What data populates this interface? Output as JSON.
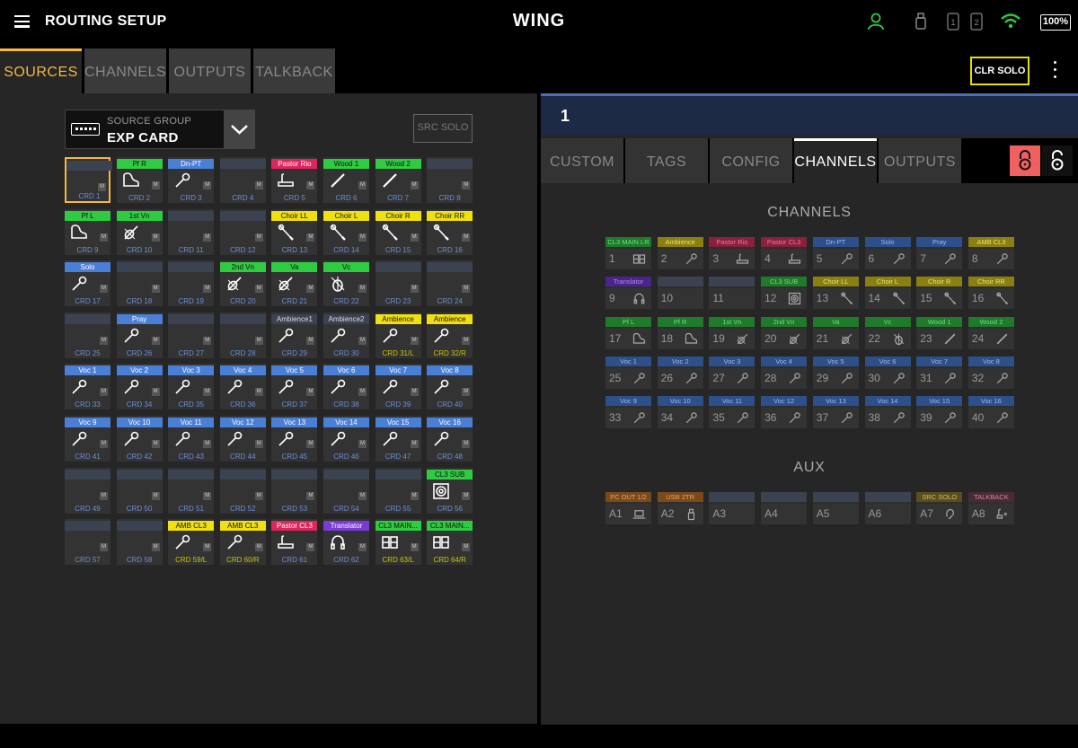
{
  "topbar": {
    "title": "ROUTING SETUP",
    "brand": "WING",
    "battery": "100%",
    "icons": [
      "user-icon",
      "usb-drive-icon",
      "card-slot-1-icon",
      "card-slot-2-icon",
      "wifi-icon",
      "battery-icon"
    ],
    "slot1": "1",
    "slot2": "2"
  },
  "left_tabs": [
    {
      "label": "SOURCES",
      "active": true
    },
    {
      "label": "CHANNELS",
      "active": false
    },
    {
      "label": "OUTPUTS",
      "active": false
    },
    {
      "label": "TALKBACK",
      "active": false
    }
  ],
  "source_group": {
    "label": "SOURCE GROUP",
    "value": "EXP CARD"
  },
  "src_solo_label": "SRC SOLO",
  "clr_solo_label": "CLR SOLO",
  "colors": {
    "green": "#2ecc40",
    "blue": "#4a7fd6",
    "red": "#e0245e",
    "yellow": "#f0e010",
    "purple": "#7a3ad6",
    "empty": "#3b4250",
    "accent": "#f6b93b"
  },
  "sources": [
    {
      "name": "CRD 1",
      "tag": "",
      "color": "empty",
      "icon": "",
      "selected": true
    },
    {
      "name": "CRD 2",
      "tag": "Pf R",
      "color": "green",
      "icon": "piano"
    },
    {
      "name": "CRD 3",
      "tag": "Dn-PT",
      "color": "blue",
      "icon": "mic"
    },
    {
      "name": "CRD 4",
      "tag": "",
      "color": "empty",
      "icon": ""
    },
    {
      "name": "CRD 5",
      "tag": "Pastor Rio",
      "color": "red",
      "icon": "podium"
    },
    {
      "name": "CRD 6",
      "tag": "Wood 1",
      "color": "green",
      "icon": "flute"
    },
    {
      "name": "CRD 7",
      "tag": "Wood 2",
      "color": "green",
      "icon": "flute"
    },
    {
      "name": "CRD 8",
      "tag": "",
      "color": "empty",
      "icon": ""
    },
    {
      "name": "CRD 9",
      "tag": "Pf L",
      "color": "green",
      "icon": "piano"
    },
    {
      "name": "CRD 10",
      "tag": "1st Vn",
      "color": "green",
      "icon": "violin"
    },
    {
      "name": "CRD 11",
      "tag": "",
      "color": "empty",
      "icon": ""
    },
    {
      "name": "CRD 12",
      "tag": "",
      "color": "empty",
      "icon": ""
    },
    {
      "name": "CRD 13",
      "tag": "Choir LL",
      "color": "yellow",
      "icon": "mic-hang"
    },
    {
      "name": "CRD 14",
      "tag": "Choir L",
      "color": "yellow",
      "icon": "mic-hang"
    },
    {
      "name": "CRD 15",
      "tag": "Choir R",
      "color": "yellow",
      "icon": "mic-hang"
    },
    {
      "name": "CRD 16",
      "tag": "Choir RR",
      "color": "yellow",
      "icon": "mic-hang"
    },
    {
      "name": "CRD 17",
      "tag": "Solo",
      "color": "blue",
      "icon": "mic"
    },
    {
      "name": "CRD 18",
      "tag": "",
      "color": "empty",
      "icon": ""
    },
    {
      "name": "CRD 19",
      "tag": "",
      "color": "empty",
      "icon": ""
    },
    {
      "name": "CRD 20",
      "tag": "2nd Vn",
      "color": "green",
      "icon": "violin"
    },
    {
      "name": "CRD 21",
      "tag": "Va",
      "color": "green",
      "icon": "violin"
    },
    {
      "name": "CRD 22",
      "tag": "Vc",
      "color": "green",
      "icon": "cello"
    },
    {
      "name": "CRD 23",
      "tag": "",
      "color": "empty",
      "icon": ""
    },
    {
      "name": "CRD 24",
      "tag": "",
      "color": "empty",
      "icon": ""
    },
    {
      "name": "CRD 25",
      "tag": "",
      "color": "empty",
      "icon": ""
    },
    {
      "name": "CRD 26",
      "tag": "Pray",
      "color": "blue",
      "icon": "mic"
    },
    {
      "name": "CRD 27",
      "tag": "",
      "color": "empty",
      "icon": ""
    },
    {
      "name": "CRD 28",
      "tag": "",
      "color": "empty",
      "icon": ""
    },
    {
      "name": "CRD 29",
      "tag": "Ambience1",
      "color": "empty",
      "icon": "mic",
      "textcolor": "#ddd"
    },
    {
      "name": "CRD 30",
      "tag": "Ambience2",
      "color": "empty",
      "icon": "mic",
      "textcolor": "#ddd"
    },
    {
      "name": "CRD 31/L",
      "tag": "Ambience",
      "color": "yellow",
      "icon": "mic",
      "namecolor": "#c8c800"
    },
    {
      "name": "CRD 32/R",
      "tag": "Ambience",
      "color": "yellow",
      "icon": "mic",
      "namecolor": "#c8c800"
    },
    {
      "name": "CRD 33",
      "tag": "Voc 1",
      "color": "blue",
      "icon": "mic"
    },
    {
      "name": "CRD 34",
      "tag": "Voc 2",
      "color": "blue",
      "icon": "mic"
    },
    {
      "name": "CRD 35",
      "tag": "Voc 3",
      "color": "blue",
      "icon": "mic"
    },
    {
      "name": "CRD 36",
      "tag": "Voc 4",
      "color": "blue",
      "icon": "mic"
    },
    {
      "name": "CRD 37",
      "tag": "Voc 5",
      "color": "blue",
      "icon": "mic"
    },
    {
      "name": "CRD 38",
      "tag": "Voc 6",
      "color": "blue",
      "icon": "mic"
    },
    {
      "name": "CRD 39",
      "tag": "Voc 7",
      "color": "blue",
      "icon": "mic"
    },
    {
      "name": "CRD 40",
      "tag": "Voc 8",
      "color": "blue",
      "icon": "mic"
    },
    {
      "name": "CRD 41",
      "tag": "Voc 9",
      "color": "blue",
      "icon": "mic"
    },
    {
      "name": "CRD 42",
      "tag": "Voc 10",
      "color": "blue",
      "icon": "mic"
    },
    {
      "name": "CRD 43",
      "tag": "Voc 11",
      "color": "blue",
      "icon": "mic"
    },
    {
      "name": "CRD 44",
      "tag": "Voc 12",
      "color": "blue",
      "icon": "mic"
    },
    {
      "name": "CRD 45",
      "tag": "Voc 13",
      "color": "blue",
      "icon": "mic"
    },
    {
      "name": "CRD 46",
      "tag": "Voc 14",
      "color": "blue",
      "icon": "mic"
    },
    {
      "name": "CRD 47",
      "tag": "Voc 15",
      "color": "blue",
      "icon": "mic"
    },
    {
      "name": "CRD 48",
      "tag": "Voc 16",
      "color": "blue",
      "icon": "mic"
    },
    {
      "name": "CRD 49",
      "tag": "",
      "color": "empty",
      "icon": ""
    },
    {
      "name": "CRD 50",
      "tag": "",
      "color": "empty",
      "icon": ""
    },
    {
      "name": "CRD 51",
      "tag": "",
      "color": "empty",
      "icon": ""
    },
    {
      "name": "CRD 52",
      "tag": "",
      "color": "empty",
      "icon": ""
    },
    {
      "name": "CRD 53",
      "tag": "",
      "color": "empty",
      "icon": ""
    },
    {
      "name": "CRD 54",
      "tag": "",
      "color": "empty",
      "icon": ""
    },
    {
      "name": "CRD 55",
      "tag": "",
      "color": "empty",
      "icon": ""
    },
    {
      "name": "CRD 56",
      "tag": "CL3 SUB",
      "color": "green",
      "icon": "speaker"
    },
    {
      "name": "CRD 57",
      "tag": "",
      "color": "empty",
      "icon": ""
    },
    {
      "name": "CRD 58",
      "tag": "",
      "color": "empty",
      "icon": ""
    },
    {
      "name": "CRD 59/L",
      "tag": "AMB CL3",
      "color": "yellow",
      "icon": "mic",
      "namecolor": "#c8c800"
    },
    {
      "name": "CRD 60/R",
      "tag": "AMB CL3",
      "color": "yellow",
      "icon": "mic",
      "namecolor": "#c8c800"
    },
    {
      "name": "CRD 61",
      "tag": "Pastor CL3",
      "color": "red",
      "icon": "podium"
    },
    {
      "name": "CRD 62",
      "tag": "Translator",
      "color": "purple",
      "icon": "headset"
    },
    {
      "name": "CRD 63/L",
      "tag": "CL3 MAIN...",
      "color": "green",
      "icon": "console",
      "namecolor": "#c8c800"
    },
    {
      "name": "CRD 64/R",
      "tag": "CL3 MAIN...",
      "color": "green",
      "icon": "console",
      "namecolor": "#c8c800"
    }
  ],
  "right_header": {
    "number": "1"
  },
  "right_tabs": [
    {
      "label": "CUSTOM",
      "active": false
    },
    {
      "label": "TAGS",
      "active": false
    },
    {
      "label": "CONFIG",
      "active": false
    },
    {
      "label": "CHANNELS",
      "active": true
    },
    {
      "label": "OUTPUTS",
      "active": false
    }
  ],
  "channels_title": "CHANNELS",
  "channels": [
    {
      "num": "1",
      "tag": "CL3 MAIN LR",
      "color": "green",
      "icon": "console"
    },
    {
      "num": "2",
      "tag": "Ambience",
      "color": "yellow",
      "icon": "mic"
    },
    {
      "num": "3",
      "tag": "Pastor Rio",
      "color": "red",
      "icon": "podium"
    },
    {
      "num": "4",
      "tag": "Pastor CL3",
      "color": "red",
      "icon": "podium"
    },
    {
      "num": "5",
      "tag": "Dn-PT",
      "color": "blue",
      "icon": "mic"
    },
    {
      "num": "6",
      "tag": "Solo",
      "color": "blue",
      "icon": "mic"
    },
    {
      "num": "7",
      "tag": "Pray",
      "color": "blue",
      "icon": "mic"
    },
    {
      "num": "8",
      "tag": "AMB CL3",
      "color": "yellow",
      "icon": "mic"
    },
    {
      "num": "9",
      "tag": "Translator",
      "color": "purple",
      "icon": "headset"
    },
    {
      "num": "10",
      "tag": "",
      "color": "empty",
      "icon": ""
    },
    {
      "num": "11",
      "tag": "",
      "color": "empty",
      "icon": ""
    },
    {
      "num": "12",
      "tag": "CL3 SUB",
      "color": "green",
      "icon": "speaker"
    },
    {
      "num": "13",
      "tag": "Choir LL",
      "color": "yellow",
      "icon": "mic-hang"
    },
    {
      "num": "14",
      "tag": "Choir L",
      "color": "yellow",
      "icon": "mic-hang"
    },
    {
      "num": "15",
      "tag": "Choir R",
      "color": "yellow",
      "icon": "mic-hang"
    },
    {
      "num": "16",
      "tag": "Choir RR",
      "color": "yellow",
      "icon": "mic-hang"
    },
    {
      "num": "17",
      "tag": "Pf L",
      "color": "green",
      "icon": "piano"
    },
    {
      "num": "18",
      "tag": "Pf R",
      "color": "green",
      "icon": "piano"
    },
    {
      "num": "19",
      "tag": "1st Vn",
      "color": "green",
      "icon": "violin"
    },
    {
      "num": "20",
      "tag": "2nd Vn",
      "color": "green",
      "icon": "violin"
    },
    {
      "num": "21",
      "tag": "Va",
      "color": "green",
      "icon": "violin"
    },
    {
      "num": "22",
      "tag": "Vc",
      "color": "green",
      "icon": "cello"
    },
    {
      "num": "23",
      "tag": "Wood 1",
      "color": "green",
      "icon": "flute"
    },
    {
      "num": "24",
      "tag": "Wood 2",
      "color": "green",
      "icon": "flute"
    },
    {
      "num": "25",
      "tag": "Voc 1",
      "color": "blue",
      "icon": "mic"
    },
    {
      "num": "26",
      "tag": "Voc 2",
      "color": "blue",
      "icon": "mic"
    },
    {
      "num": "27",
      "tag": "Voc 3",
      "color": "blue",
      "icon": "mic"
    },
    {
      "num": "28",
      "tag": "Voc 4",
      "color": "blue",
      "icon": "mic"
    },
    {
      "num": "29",
      "tag": "Voc 5",
      "color": "blue",
      "icon": "mic"
    },
    {
      "num": "30",
      "tag": "Voc 6",
      "color": "blue",
      "icon": "mic"
    },
    {
      "num": "31",
      "tag": "Voc 7",
      "color": "blue",
      "icon": "mic"
    },
    {
      "num": "32",
      "tag": "Voc 8",
      "color": "blue",
      "icon": "mic"
    },
    {
      "num": "33",
      "tag": "Voc 9",
      "color": "blue",
      "icon": "mic"
    },
    {
      "num": "34",
      "tag": "Voc 10",
      "color": "blue",
      "icon": "mic"
    },
    {
      "num": "35",
      "tag": "Voc 11",
      "color": "blue",
      "icon": "mic"
    },
    {
      "num": "36",
      "tag": "Voc 12",
      "color": "blue",
      "icon": "mic"
    },
    {
      "num": "37",
      "tag": "Voc 13",
      "color": "blue",
      "icon": "mic"
    },
    {
      "num": "38",
      "tag": "Voc 14",
      "color": "blue",
      "icon": "mic"
    },
    {
      "num": "39",
      "tag": "Voc 15",
      "color": "blue",
      "icon": "mic"
    },
    {
      "num": "40",
      "tag": "Voc 16",
      "color": "blue",
      "icon": "mic"
    }
  ],
  "aux_title": "AUX",
  "aux": [
    {
      "num": "A1",
      "tag": "PC OUT 1/2",
      "color": "orange",
      "icon": "laptop"
    },
    {
      "num": "A2",
      "tag": "USB 2TR",
      "color": "orange",
      "icon": "usb"
    },
    {
      "num": "A3",
      "tag": "",
      "color": "empty",
      "icon": ""
    },
    {
      "num": "A4",
      "tag": "",
      "color": "empty",
      "icon": ""
    },
    {
      "num": "A5",
      "tag": "",
      "color": "empty",
      "icon": ""
    },
    {
      "num": "A6",
      "tag": "",
      "color": "empty",
      "icon": ""
    },
    {
      "num": "A7",
      "tag": "SRC SOLO",
      "color": "olive",
      "icon": "ear"
    },
    {
      "num": "A8",
      "tag": "TALKBACK",
      "color": "mauve",
      "icon": "talkback"
    }
  ]
}
